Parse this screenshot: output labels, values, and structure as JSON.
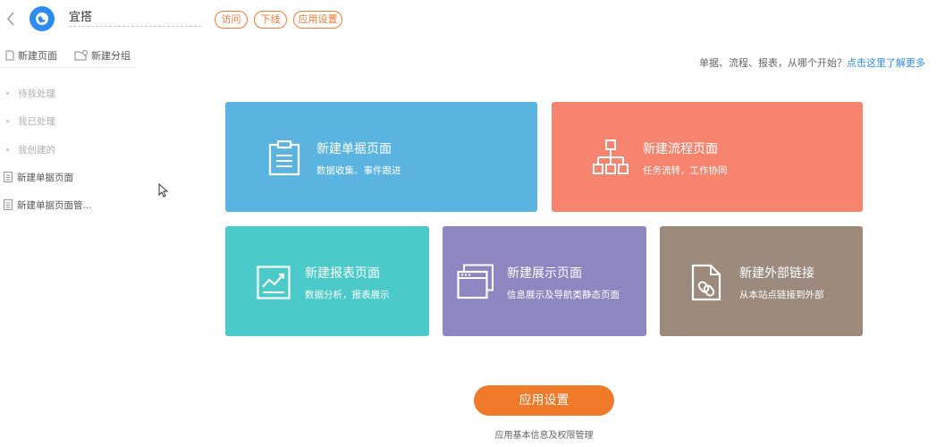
{
  "header": {
    "app_name": "宜搭",
    "pills": [
      "访问",
      "下线",
      "应用设置"
    ]
  },
  "sidebar": {
    "tools": [
      {
        "label": "新建页面",
        "icon": "new-page-icon"
      },
      {
        "label": "新建分组",
        "icon": "new-group-icon"
      }
    ],
    "items": [
      {
        "label": "待我处理",
        "type": "muted"
      },
      {
        "label": "我已处理",
        "type": "muted"
      },
      {
        "label": "我创建的",
        "type": "muted"
      },
      {
        "label": "新建单据页面",
        "type": "page"
      },
      {
        "label": "新建单据页面管...",
        "type": "page"
      }
    ]
  },
  "hint": {
    "text": "单据、流程、报表，从哪个开始？",
    "link": "点击这里了解更多"
  },
  "cards": [
    {
      "title": "新建单据页面",
      "sub": "数据收集、事件跟进",
      "icon": "clipboard-icon",
      "color": "#5ab4df"
    },
    {
      "title": "新建流程页面",
      "sub": "任务流转，工作协同",
      "icon": "flowchart-icon",
      "color": "#f7846f"
    },
    {
      "title": "新建报表页面",
      "sub": "数据分析，报表展示",
      "icon": "chart-report-icon",
      "color": "#4cc9c9"
    },
    {
      "title": "新建展示页面",
      "sub": "信息展示及导航类静态页面",
      "icon": "browser-window-icon",
      "color": "#8c87c0"
    },
    {
      "title": "新建外部链接",
      "sub": "从本站点链接到外部",
      "icon": "link-document-icon",
      "color": "#9c8a7c"
    }
  ],
  "footer": {
    "button": "应用设置",
    "caption": "应用基本信息及权限管理"
  }
}
